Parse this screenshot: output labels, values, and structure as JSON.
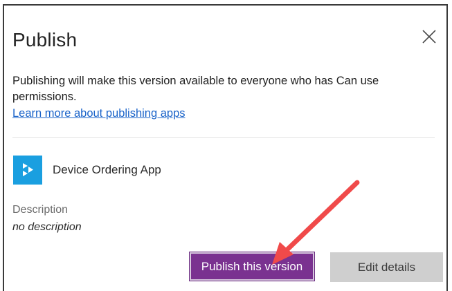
{
  "dialog": {
    "title": "Publish",
    "close_icon": "close-icon",
    "message": "Publishing will make this version available to everyone who has Can use permissions.",
    "learn_more_link": "Learn more about publishing apps"
  },
  "app": {
    "icon": "power-apps-icon",
    "icon_color": "#1a9fe0",
    "name": "Device Ordering App"
  },
  "description": {
    "label": "Description",
    "value": "no description"
  },
  "actions": {
    "publish_label": "Publish this version",
    "publish_color": "#7a3290",
    "edit_label": "Edit details"
  },
  "annotation": {
    "arrow_color": "#f04a4a"
  }
}
